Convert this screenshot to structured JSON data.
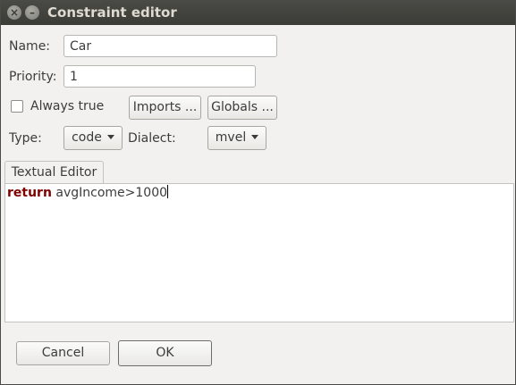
{
  "window": {
    "title": "Constraint editor",
    "close_glyph": "×",
    "minimize_glyph": "–"
  },
  "form": {
    "name_label": "Name:",
    "name_value": "Car",
    "priority_label": "Priority:",
    "priority_value": "1",
    "always_true_label": "Always true",
    "always_true_checked": false,
    "imports_label": "Imports ...",
    "globals_label": "Globals ...",
    "type_label": "Type:",
    "type_value": "code",
    "dialect_label": "Dialect:",
    "dialect_value": "mvel"
  },
  "editor": {
    "tab_label": "Textual Editor",
    "keyword": "return",
    "expression": " avgIncome>1000",
    "keyword_color": "#7f0000"
  },
  "footer": {
    "cancel_label": "Cancel",
    "ok_label": "OK"
  }
}
